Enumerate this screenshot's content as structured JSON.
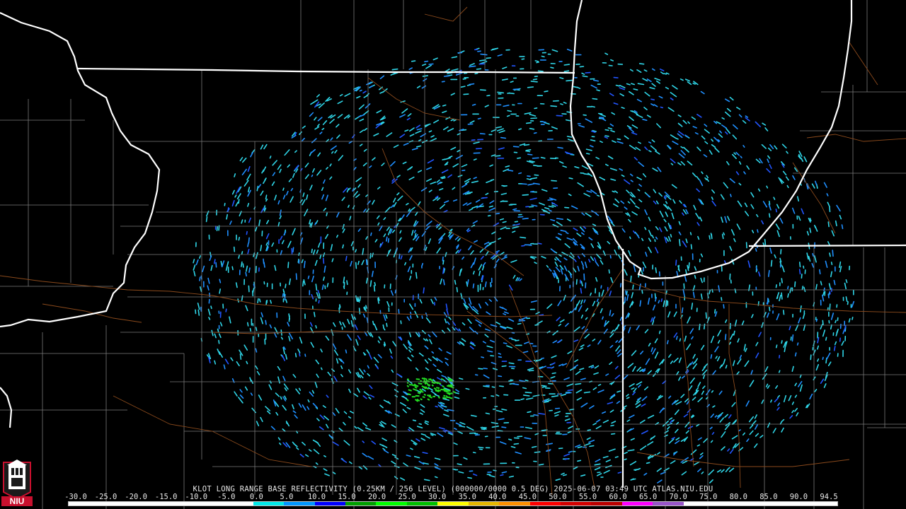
{
  "caption": "KLOT LONG RANGE BASE REFLECTIVITY (0.25KM / 256 LEVEL) (000000/0000 0.5 DEG) 2025-06-07 03:49 UTC  ATLAS.NIU.EDU",
  "logo": {
    "text": "NIU",
    "icon": "niu-tower-logo-icon"
  },
  "legend": {
    "labels": [
      "-30.0",
      "-25.0",
      "-20.0",
      "-15.0",
      "-10.0",
      "-5.0",
      "0.0",
      "5.0",
      "10.0",
      "15.0",
      "20.0",
      "25.0",
      "30.0",
      "35.0",
      "40.0",
      "45.0",
      "50.0",
      "55.0",
      "60.0",
      "65.0",
      "70.0",
      "75.0",
      "80.0",
      "85.0",
      "90.0",
      "94.5"
    ],
    "colors": [
      "#ffffff",
      "#ffffff",
      "#ffffff",
      "#ffffff",
      "#ffffff",
      "#ffffff",
      "#00e8e8",
      "#0096ff",
      "#0000ff",
      "#00a000",
      "#00ff00",
      "#00c000",
      "#ffff00",
      "#e6b800",
      "#ff9000",
      "#ff0000",
      "#d40000",
      "#bc0000",
      "#ff00ff",
      "#9955c9",
      "#ffffff",
      "#ffffff",
      "#ffffff",
      "#ffffff",
      "#ffffff"
    ]
  },
  "colors": {
    "background": "#000000",
    "state_border": "#ffffff",
    "county_line": "#7a7a7a",
    "road": "#8b4a1c",
    "echo_light": "#2fd6e8",
    "echo_mid": "#1f8fff",
    "echo_deep": "#2255ff",
    "echo_green": "#22dd22"
  },
  "radar_site": "KLOT"
}
